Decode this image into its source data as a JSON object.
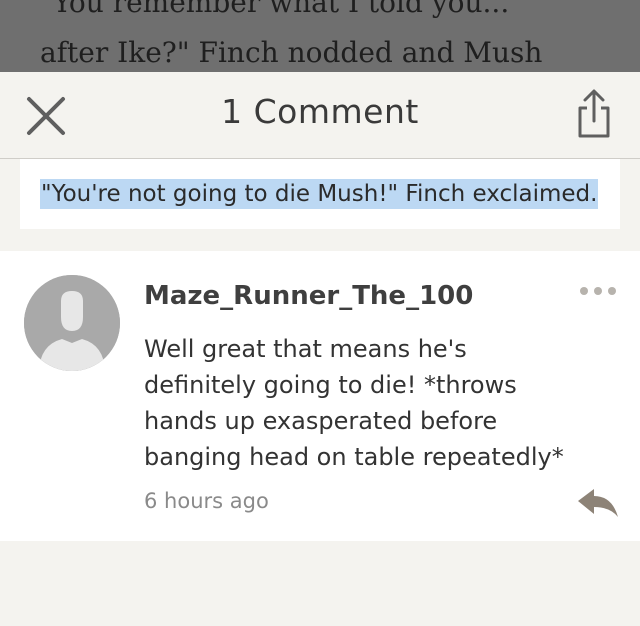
{
  "story": {
    "line1": "\"You remember what I told you...",
    "line2": "after Ike?\" Finch nodded and Mush"
  },
  "header": {
    "title": "1 Comment",
    "close_icon": "close-icon",
    "share_icon": "share-icon"
  },
  "quote": {
    "text": "\"You're not going to die Mush!\" Finch exclaimed.",
    "highlight_color": "#bcd8f3"
  },
  "comment": {
    "username": "Maze_Runner_The_100",
    "text": "Well great that means he's definitely going to die! *throws hands up exasperated before banging head on table repeatedly*",
    "timestamp": "6 hours ago",
    "avatar_icon": "default-avatar-icon",
    "more_icon": "more-dots-icon",
    "reply_icon": "reply-icon"
  }
}
